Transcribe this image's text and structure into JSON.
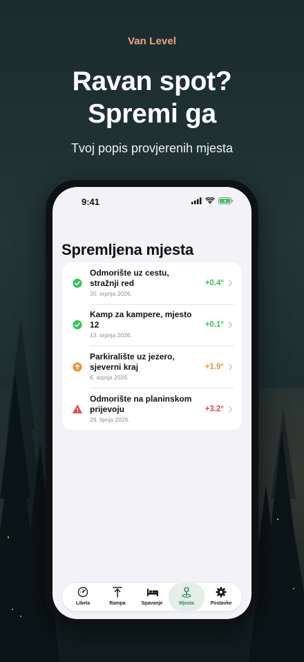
{
  "promo": {
    "eyebrow": "Van Level",
    "headline_line1": "Ravan spot?",
    "headline_line2": "Spremi ga",
    "subline": "Tvoj popis provjerenih mjesta"
  },
  "status_bar": {
    "time": "9:41"
  },
  "screen": {
    "title": "Spremljena mjesta",
    "places": [
      {
        "name": "Odmorište uz cestu, stražnji red",
        "date": "20. srpnja 2026.",
        "value": "+0.4°",
        "status": "level",
        "status_icon": "check-circle-icon",
        "color": "#34c759"
      },
      {
        "name": "Kamp za kampere, mjesto 12",
        "date": "13. srpnja 2026.",
        "value": "+0.1°",
        "status": "level",
        "status_icon": "check-circle-icon",
        "color": "#34c759"
      },
      {
        "name": "Parkiralište uz jezero, sjeverni kraj",
        "date": "6. srpnja 2026.",
        "value": "+1.9°",
        "status": "slight",
        "status_icon": "arrow-up-circle-icon",
        "color": "#f0932f"
      },
      {
        "name": "Odmorište na planinskom prijevoju",
        "date": "29. lipnja 2026.",
        "value": "+3.2°",
        "status": "warning",
        "status_icon": "warning-triangle-icon",
        "color": "#e5484d"
      }
    ]
  },
  "tabbar": {
    "items": [
      {
        "label": "Libela",
        "icon": "gauge-icon"
      },
      {
        "label": "Rampa",
        "icon": "arrow-up-bar-icon"
      },
      {
        "label": "Spavanje",
        "icon": "bed-icon"
      },
      {
        "label": "Mjesta",
        "icon": "map-pin-icon",
        "active": true
      },
      {
        "label": "Postavke",
        "icon": "gear-icon"
      }
    ]
  },
  "colors": {
    "accent_green": "#34c759",
    "accent_orange": "#f0932f",
    "accent_red": "#e5484d",
    "eyebrow": "#f0a183",
    "active_tab": "#2f8a57"
  }
}
